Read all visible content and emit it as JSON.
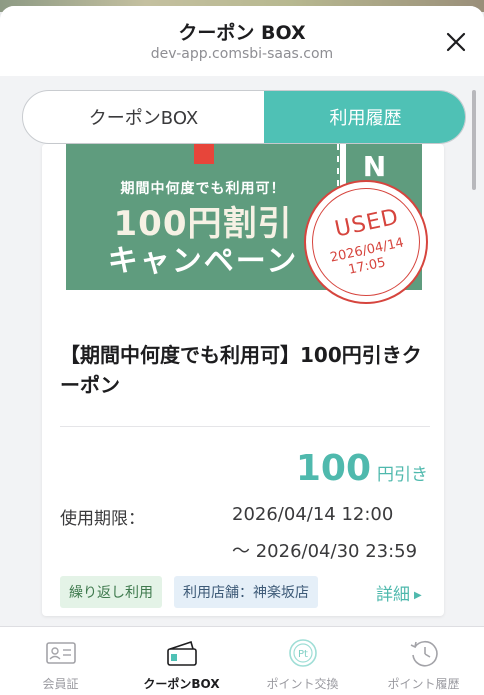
{
  "header": {
    "title": "クーポン BOX",
    "url": "dev-app.comsbi-saas.com",
    "close_icon": "close-icon"
  },
  "segment": {
    "tabs": [
      {
        "label": "クーポンBOX",
        "selected": false
      },
      {
        "label": "利用履歴",
        "selected": true
      }
    ],
    "accent": "#4fc1b5"
  },
  "coupon": {
    "banner": {
      "line1": "期間中何度でも利用可！",
      "line2": "100円割引",
      "line3": "キャンペーン",
      "side_text": "NO",
      "color": "#5f9c7e"
    },
    "stamp": {
      "label": "USED",
      "date": "2026/04/14",
      "time": "17:05",
      "color": "#d6453e"
    },
    "title": "【期間中何度でも利用可】100円引きクーポン",
    "amount": "100",
    "amount_unit": "円引き",
    "expiry_label": "使用期限：",
    "expiry_start": "2026/04/14 12:00",
    "expiry_end": "～ 2026/04/30 23:59",
    "tags": [
      {
        "label": "繰り返し利用"
      },
      {
        "label": "利用店舗：神楽坂店"
      }
    ],
    "detail_link": "詳細"
  },
  "tabbar": {
    "items": [
      {
        "label": "会員証",
        "icon": "member-card-icon",
        "active": false
      },
      {
        "label": "クーポンBOX",
        "icon": "coupon-box-icon",
        "active": true
      },
      {
        "label": "ポイント交換",
        "icon": "point-exchange-icon",
        "active": false
      },
      {
        "label": "ポイント履歴",
        "icon": "point-history-icon",
        "active": false
      }
    ]
  }
}
